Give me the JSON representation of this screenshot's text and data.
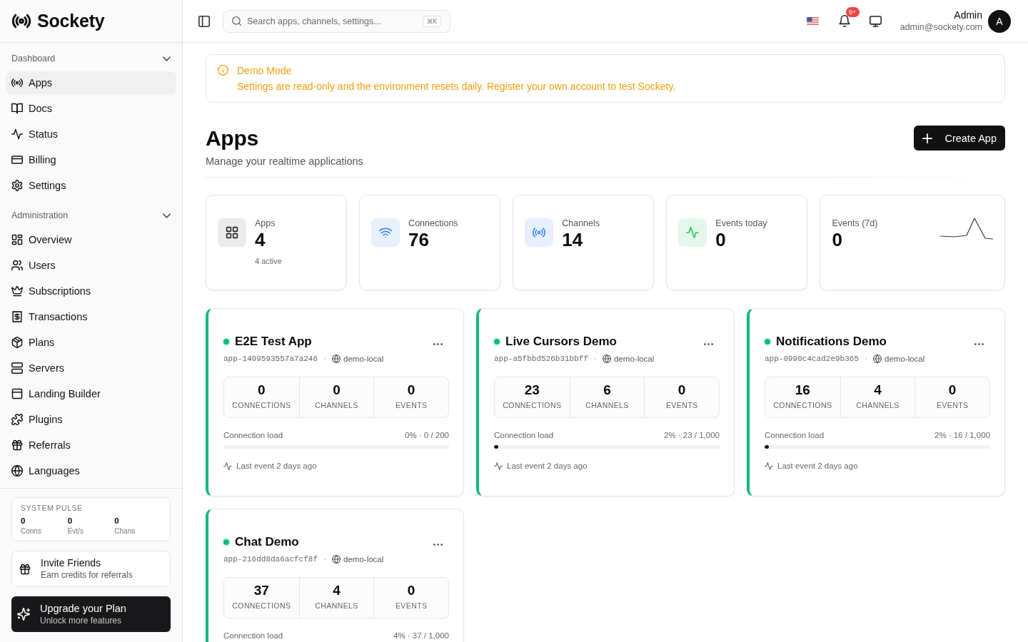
{
  "sidebar": {
    "logo": "Sockety",
    "sections": [
      {
        "title": "Dashboard",
        "expanded": true,
        "items": [
          {
            "label": "Apps",
            "selected": true
          },
          {
            "label": "Docs",
            "selected": false
          },
          {
            "label": "Status",
            "selected": false
          },
          {
            "label": "Billing",
            "selected": false
          },
          {
            "label": "Settings",
            "selected": false
          }
        ]
      },
      {
        "title": "Administration",
        "expanded": true,
        "items": [
          {
            "label": "Overview",
            "selected": false
          },
          {
            "label": "Users",
            "selected": false
          },
          {
            "label": "Subscriptions",
            "selected": false
          },
          {
            "label": "Transactions",
            "selected": false
          },
          {
            "label": "Plans",
            "selected": false
          },
          {
            "label": "Servers",
            "selected": false
          },
          {
            "label": "Landing Builder",
            "selected": false
          },
          {
            "label": "Plugins",
            "selected": false
          },
          {
            "label": "Referrals",
            "selected": false
          },
          {
            "label": "Languages",
            "selected": false
          }
        ]
      }
    ],
    "system_pulse": {
      "title": "SYSTEM PULSE",
      "stats": [
        {
          "value": "0",
          "label": "Conns"
        },
        {
          "value": "0",
          "label": "Evt/s"
        },
        {
          "value": "0",
          "label": "Chans"
        }
      ]
    },
    "invite": {
      "title": "Invite Friends",
      "subtitle": "Earn credits for referrals"
    },
    "upgrade": {
      "title": "Upgrade your Plan",
      "subtitle": "Unlock more features"
    }
  },
  "header": {
    "search": {
      "placeholder": "Search apps, channels, settings...",
      "shortcut": "⌘K"
    },
    "notification_count": "9+",
    "user": {
      "name": "Admin",
      "email": "admin@sockety.com",
      "initial": "A"
    }
  },
  "alert": {
    "title": "Demo Mode",
    "message": "Settings are read-only and the environment resets daily. Register your own account to test Sockety."
  },
  "page": {
    "title": "Apps",
    "subtitle": "Manage your realtime applications",
    "create_button": "Create App"
  },
  "stats": [
    {
      "kind": "tile",
      "label": "Apps",
      "value": "4",
      "note": "4 active"
    },
    {
      "kind": "tile",
      "label": "Connections",
      "value": "76"
    },
    {
      "kind": "tile",
      "label": "Channels",
      "value": "14"
    },
    {
      "kind": "tile",
      "label": "Events today",
      "value": "0"
    },
    {
      "kind": "trend",
      "label": "Events (7d)",
      "value": "0"
    }
  ],
  "apps": [
    {
      "name": "E2E Test App",
      "active": true,
      "app_id": "app-1409593557a7a246",
      "environment": "demo-local",
      "metrics": [
        {
          "value": "0",
          "label": "CONNECTIONS"
        },
        {
          "value": "0",
          "label": "CHANNELS"
        },
        {
          "value": "0",
          "label": "EVENTS"
        }
      ],
      "load_label": "Connection load",
      "load_text": "0% · 0 / 200",
      "level": 0,
      "last_event": "Last event 2 days ago"
    },
    {
      "name": "Live Cursors Demo",
      "active": true,
      "app_id": "app-a5fbbd526b31bbff",
      "environment": "demo-local",
      "metrics": [
        {
          "value": "23",
          "label": "CONNECTIONS"
        },
        {
          "value": "6",
          "label": "CHANNELS"
        },
        {
          "value": "0",
          "label": "EVENTS"
        }
      ],
      "load_label": "Connection load",
      "load_text": "2% · 23 / 1,000",
      "level": 0.02,
      "last_event": "Last event 2 days ago"
    },
    {
      "name": "Notifications Demo",
      "active": true,
      "app_id": "app-0990c4cad2e9b365",
      "environment": "demo-local",
      "metrics": [
        {
          "value": "16",
          "label": "CONNECTIONS"
        },
        {
          "value": "4",
          "label": "CHANNELS"
        },
        {
          "value": "0",
          "label": "EVENTS"
        }
      ],
      "load_label": "Connection load",
      "load_text": "2% · 16 / 1,000",
      "level": 0.02,
      "last_event": "Last event 2 days ago"
    },
    {
      "name": "Chat Demo",
      "active": true,
      "app_id": "app-216dd8da6acfcf8f",
      "environment": "demo-local",
      "metrics": [
        {
          "value": "37",
          "label": "CONNECTIONS"
        },
        {
          "value": "4",
          "label": "CHANNELS"
        },
        {
          "value": "0",
          "label": "EVENTS"
        }
      ],
      "load_label": "Connection load",
      "load_text": "4% · 37 / 1,000"
    }
  ]
}
